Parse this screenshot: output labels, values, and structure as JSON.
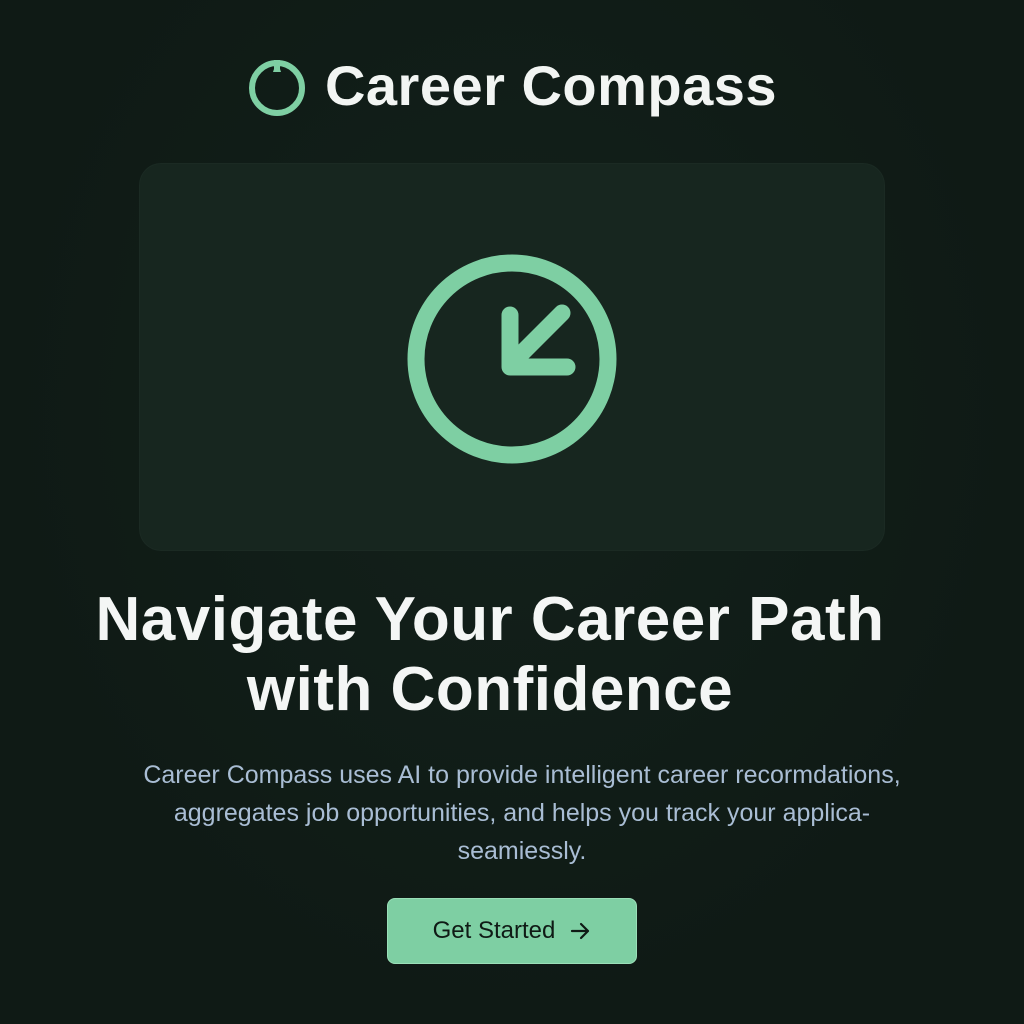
{
  "brand": {
    "name": "Career Compass",
    "logo_icon": "compass-ring-icon"
  },
  "hero": {
    "icon": "clock-arrow-icon"
  },
  "headline": {
    "line1": "Navigate Your Career Path",
    "line2": "with Confidence"
  },
  "description": {
    "line1": "Career Compass uses AI to provide intelligent career recormdations,",
    "line2": "aggregates job opportunities, and helps you track your applica-",
    "line3": "seamiessly."
  },
  "cta": {
    "label": "Get Started",
    "icon": "arrow-right-icon"
  },
  "colors": {
    "background": "#0f1a15",
    "card": "#17261f",
    "accent": "#7ecfa3",
    "heading": "#f4f6f5",
    "body_text": "#a9bdd4"
  }
}
